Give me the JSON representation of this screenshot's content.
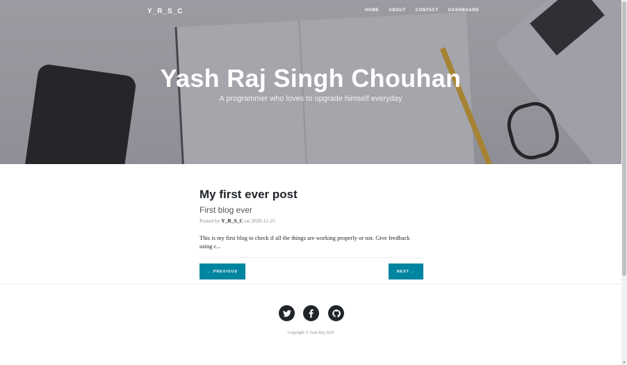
{
  "nav": {
    "brand": "Y_R_S_C",
    "links": [
      "HOME",
      "ABOUT",
      "CONTACT",
      "DASHBOARD"
    ]
  },
  "hero": {
    "title": "Yash Raj Singh Chouhan",
    "subtitle": "A programmer who loves to upgrade himself everyday"
  },
  "post": {
    "title": "My first ever post",
    "subtitle": "First blog ever",
    "meta_prefix": "Posted by ",
    "author": "Y_R_S_C",
    "meta_on": " on ",
    "date": "2020-11-25",
    "excerpt": "This is my first blog to check if all the things are working properly or not. Give feedback using c..."
  },
  "pager": {
    "previous": "← PREVIOUS",
    "next": "NEXT →"
  },
  "footer": {
    "social": [
      "twitter-icon",
      "facebook-icon",
      "github-icon"
    ],
    "copyright": "Copyright © Yash Raj 2020"
  },
  "colors": {
    "accent": "#0085a1",
    "dark": "#212529"
  }
}
